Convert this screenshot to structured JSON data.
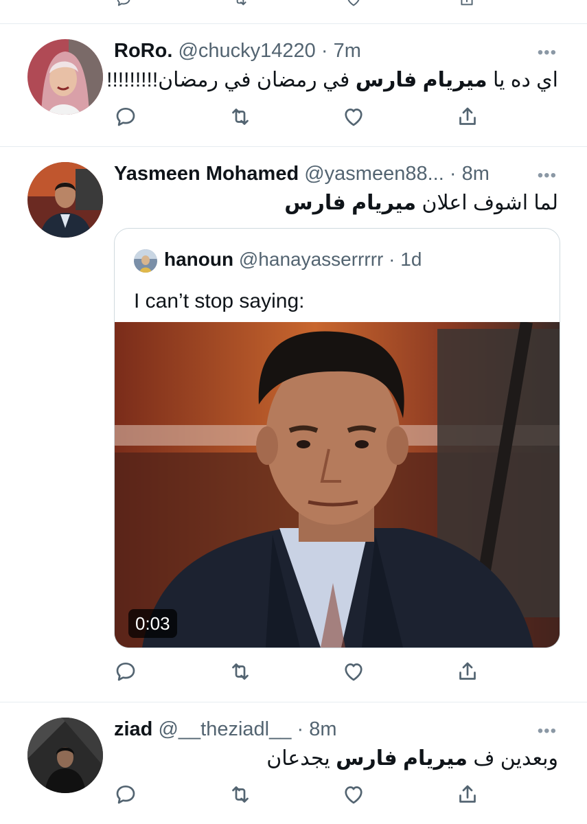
{
  "tweets": [
    {
      "display_name": "RoRo.",
      "handle": "@chucky14220",
      "sep": "·",
      "time": "7m",
      "text_before": "اي ده يا ",
      "text_bold": "ميريام فارس",
      "text_after": " في رمضان في رمضان!!!!!!!!!",
      "more": "•••"
    },
    {
      "display_name": "Yasmeen Mohamed",
      "handle": "@yasmeen88...",
      "sep": "·",
      "time": "8m",
      "text_before": "لما اشوف اعلان ",
      "text_bold": "ميريام فارس",
      "text_after": "",
      "more": "•••",
      "quoted": {
        "display_name": "hanoun",
        "handle": "@hanayasserrrrr",
        "sep": "·",
        "time": "1d",
        "text": "I can’t stop saying:",
        "video_duration": "0:03"
      }
    },
    {
      "display_name": "ziad",
      "handle": "@__theziadl__",
      "sep": "·",
      "time": "8m",
      "text_before": "وبعدين ف ",
      "text_bold": "ميريام فارس",
      "text_after": " يجدعان",
      "more": "•••"
    }
  ],
  "icons": {
    "reply": "reply-icon",
    "retweet": "retweet-icon",
    "like": "heart-icon",
    "share": "share-icon",
    "more": "more-icon"
  },
  "colors": {
    "text_primary": "#0f1419",
    "text_secondary": "#536471",
    "border": "#cfd9de",
    "divider": "#e6ecf0"
  }
}
